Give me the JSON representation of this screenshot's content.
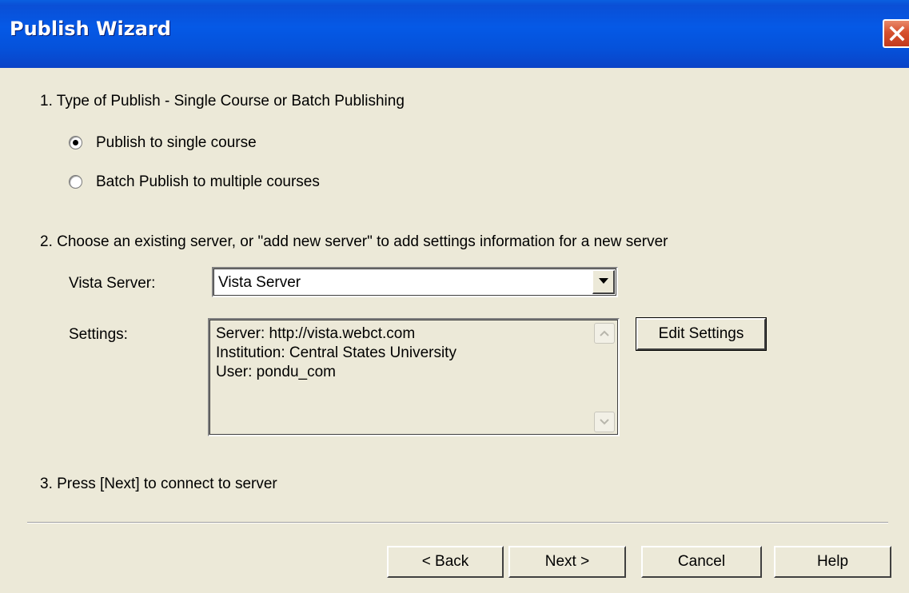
{
  "window": {
    "title": "Publish Wizard"
  },
  "step1": {
    "label": "1. Type of Publish - Single Course or Batch Publishing",
    "options": [
      {
        "label": "Publish to single course",
        "selected": true
      },
      {
        "label": "Batch Publish to multiple courses",
        "selected": false
      }
    ]
  },
  "step2": {
    "label": "2. Choose an existing server, or \"add new server\" to add settings information for a new server",
    "vista_server_label": "Vista Server:",
    "vista_server_value": "Vista Server",
    "settings_label": "Settings:",
    "settings_lines": [
      "Server: http://vista.webct.com",
      "Institution:  Central States University",
      "User: pondu_com"
    ],
    "edit_settings_label": "Edit Settings"
  },
  "step3": {
    "label": "3. Press [Next] to connect to server"
  },
  "footer": {
    "back_label": "< Back",
    "next_label": "Next >",
    "cancel_label": "Cancel",
    "help_label": "Help"
  },
  "colors": {
    "dialog_bg": "#ECE9D8",
    "titlebar_blue": "#0559E6",
    "close_red": "#D6512F"
  }
}
